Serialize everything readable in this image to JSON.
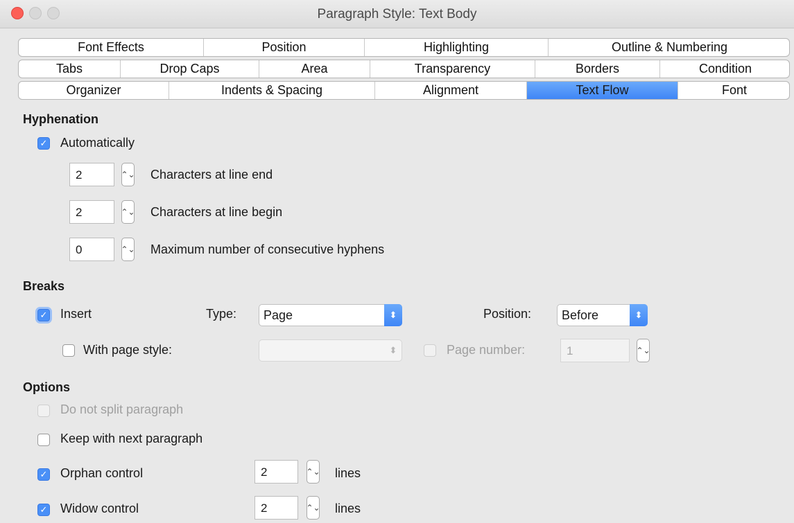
{
  "window": {
    "title": "Paragraph Style: Text Body"
  },
  "tabs": {
    "row1": [
      "Font Effects",
      "Position",
      "Highlighting",
      "Outline & Numbering"
    ],
    "row2": [
      "Tabs",
      "Drop Caps",
      "Area",
      "Transparency",
      "Borders",
      "Condition"
    ],
    "row3": [
      "Organizer",
      "Indents & Spacing",
      "Alignment",
      "Text Flow",
      "Font"
    ],
    "active": "Text Flow"
  },
  "hyphenation": {
    "heading": "Hyphenation",
    "automatically": {
      "label": "Automatically",
      "checked": true
    },
    "line_end": {
      "value": "2",
      "label": "Characters at line end"
    },
    "line_begin": {
      "value": "2",
      "label": "Characters at line begin"
    },
    "max_hyphens": {
      "value": "0",
      "label": "Maximum number of consecutive hyphens"
    }
  },
  "breaks": {
    "heading": "Breaks",
    "insert": {
      "label": "Insert",
      "checked": true
    },
    "type_label": "Type:",
    "type_value": "Page",
    "position_label": "Position:",
    "position_value": "Before",
    "with_page_style": {
      "label": "With page style:",
      "checked": false
    },
    "page_style_value": "",
    "page_number": {
      "label": "Page number:",
      "checked": false,
      "value": "1"
    }
  },
  "options": {
    "heading": "Options",
    "do_not_split": {
      "label": "Do not split paragraph",
      "checked": false,
      "disabled": true
    },
    "keep_with_next": {
      "label": "Keep with next paragraph",
      "checked": false
    },
    "orphan": {
      "label": "Orphan control",
      "checked": true,
      "value": "2",
      "unit": "lines"
    },
    "widow": {
      "label": "Widow control",
      "checked": true,
      "value": "2",
      "unit": "lines"
    }
  },
  "icons": {
    "check": "✓",
    "spin": "⌃⌄",
    "select_arrow": "⬍"
  }
}
